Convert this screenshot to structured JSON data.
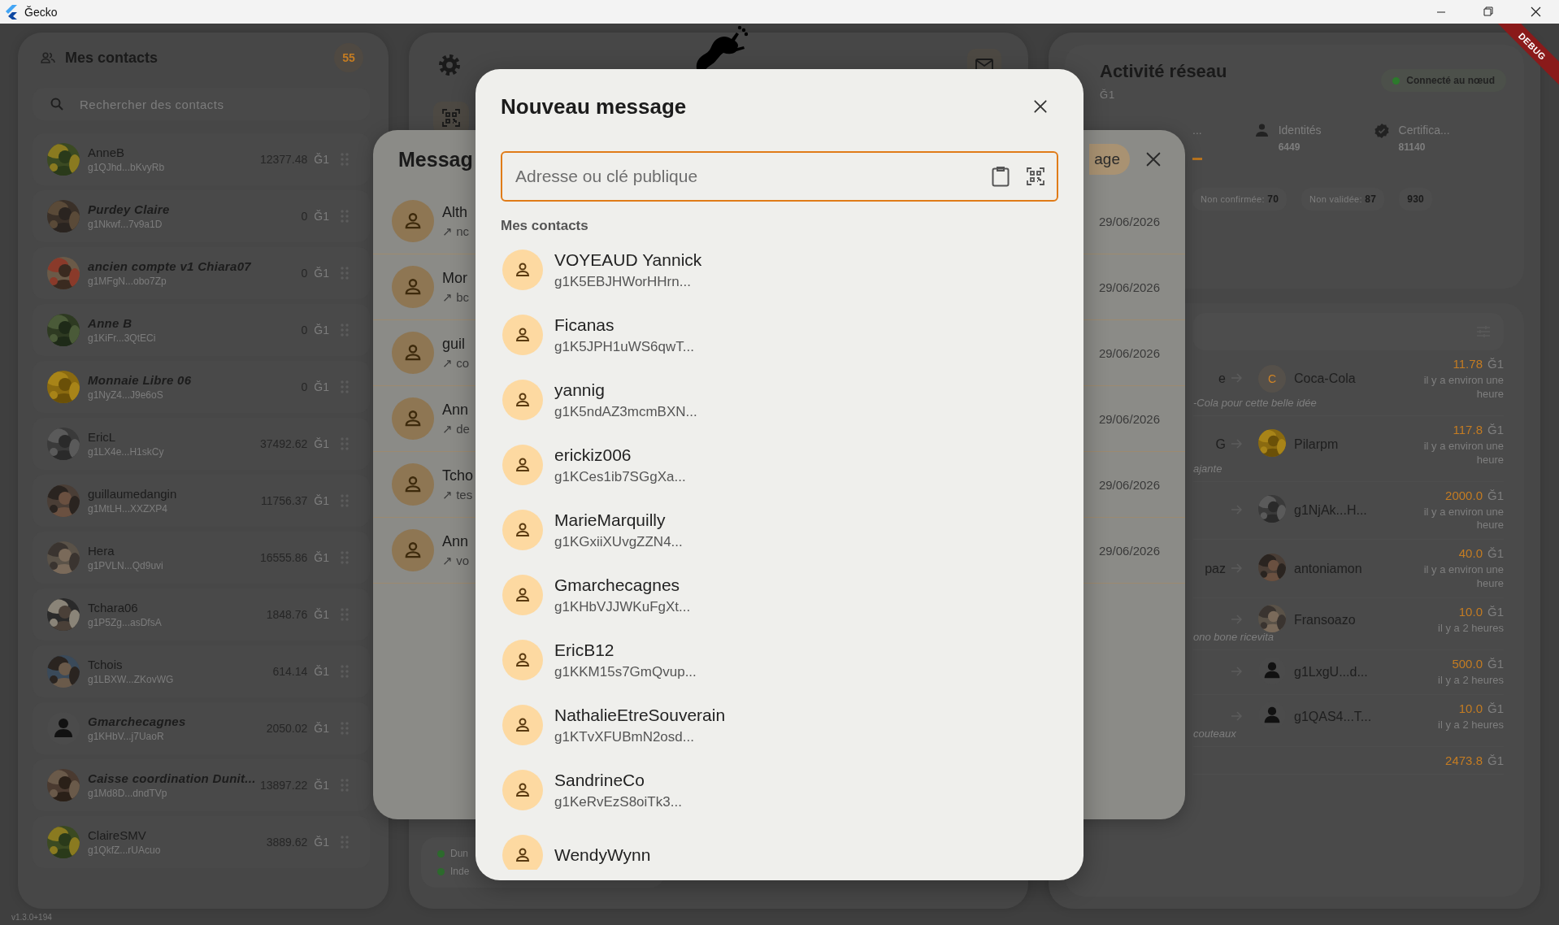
{
  "window": {
    "title": "Ğecko"
  },
  "debug_banner": "DEBUG",
  "contacts": {
    "title": "Mes contacts",
    "count": "55",
    "search": {
      "placeholder": "Rechercher des contacts"
    },
    "items": [
      {
        "name": "AnneB",
        "address": "g1QJhd...bKvyRb",
        "amount": "12377.48",
        "unit": "Ğ1",
        "italic": false
      },
      {
        "name": "Purdey Claire",
        "address": "g1Nkwf...7v9a1D",
        "amount": "0",
        "unit": "Ğ1",
        "italic": true
      },
      {
        "name": "ancien compte v1 Chiara07",
        "address": "g1MFgN...obo7Zp",
        "amount": "0",
        "unit": "Ğ1",
        "italic": true
      },
      {
        "name": "Anne B",
        "address": "g1KiFr...3QtECi",
        "amount": "0",
        "unit": "Ğ1",
        "italic": true
      },
      {
        "name": "Monnaie Libre 06",
        "address": "g1NyZ4...J9e6oS",
        "amount": "0",
        "unit": "Ğ1",
        "italic": true
      },
      {
        "name": "EricL",
        "address": "g1LX4e...H1skCy",
        "amount": "37492.62",
        "unit": "Ğ1",
        "italic": false
      },
      {
        "name": "guillaumedangin",
        "address": "g1MtLH...XXZXP4",
        "amount": "11756.37",
        "unit": "Ğ1",
        "italic": false
      },
      {
        "name": "Hera",
        "address": "g1PVLN...Qd9uvi",
        "amount": "16555.86",
        "unit": "Ğ1",
        "italic": false
      },
      {
        "name": "Tchara06",
        "address": "g1P5Zg...asDfsA",
        "amount": "1848.76",
        "unit": "Ğ1",
        "italic": false
      },
      {
        "name": "Tchois",
        "address": "g1LBXW...ZKovWG",
        "amount": "614.14",
        "unit": "Ğ1",
        "italic": false
      },
      {
        "name": "Gmarchecagnes",
        "address": "g1KHbV...j7UaoR",
        "amount": "2050.02",
        "unit": "Ğ1",
        "italic": true,
        "kind": "silhouette"
      },
      {
        "name": "Caisse coordination Dunit...",
        "address": "g1Md8D...dndTVp",
        "amount": "13897.22",
        "unit": "Ğ1",
        "italic": true
      },
      {
        "name": "ClaireSMV",
        "address": "g1QkfZ...rUAcuo",
        "amount": "3889.62",
        "unit": "Ğ1",
        "italic": false
      }
    ]
  },
  "version": "v1.3.0+194",
  "status": [
    {
      "label": "Dun",
      "connected": true
    },
    {
      "label": "Inde",
      "connected": true
    }
  ],
  "messages": {
    "title": "Messag",
    "action": "age",
    "items": [
      {
        "name": "Alth",
        "preview": "↗ nc",
        "date": "29/06/2026"
      },
      {
        "name": "Mor",
        "preview": "↗ bc",
        "date": "29/06/2026"
      },
      {
        "name": "guil",
        "preview": "↗ co",
        "date": "29/06/2026"
      },
      {
        "name": "Ann",
        "preview": "↗ de",
        "date": "29/06/2026"
      },
      {
        "name": "Tcho",
        "preview": "↗ tes",
        "date": "29/06/2026"
      },
      {
        "name": "Ann",
        "preview": "↗ vo",
        "date": "29/06/2026"
      }
    ]
  },
  "network": {
    "title": "Activité réseau",
    "currency": "Ğ1",
    "connection": {
      "label": "Connecté au nœud",
      "connected": true
    },
    "tabs": [
      {
        "label": "...",
        "selected": true
      },
      {
        "label": "Identités",
        "value": "6449",
        "selected": false
      },
      {
        "label": "Certifica...",
        "value": "81140",
        "selected": false
      }
    ],
    "chips": [
      {
        "text": "Non confirmée: **70**",
        "bold": false
      },
      {
        "text": "Non validée: **87**",
        "bold": false
      },
      {
        "text": "930",
        "bold": true
      }
    ],
    "transactions": [
      {
        "from": "e",
        "kind": "letter",
        "letter": "C",
        "to": "Coca-Cola",
        "amount": "11.78",
        "unit": "Ğ1",
        "time": "il y a environ une heure",
        "memo": "-Cola pour cette belle idée"
      },
      {
        "from": "G",
        "to": "Pilarpm",
        "amount": "117.8",
        "unit": "Ğ1",
        "time": "il y a environ une heure",
        "memo": "ajante"
      },
      {
        "to": "g1NjAk...H...",
        "amount": "2000.0",
        "unit": "Ğ1",
        "time": "il y a environ une heure"
      },
      {
        "from": "paz",
        "to": "antoniamon",
        "amount": "40.0",
        "unit": "Ğ1",
        "time": "il y a environ une heure"
      },
      {
        "to": "Fransoazo",
        "amount": "10.0",
        "unit": "Ğ1",
        "time": "il y a 2 heures",
        "memo": "ono bone ricevita"
      },
      {
        "kind": "silhouette",
        "to": "g1LxgU...d...",
        "amount": "500.0",
        "unit": "Ğ1",
        "time": "il y a 2 heures"
      },
      {
        "kind": "silhouette",
        "to": "g1QAS4...T...",
        "amount": "10.0",
        "unit": "Ğ1",
        "time": "il y a 2 heures",
        "memo": "couteaux"
      },
      {
        "amount": "2473.8",
        "unit": "Ğ1"
      }
    ]
  },
  "new_message": {
    "title": "Nouveau message",
    "field": {
      "placeholder": "Adresse ou clé publique"
    },
    "section": "Mes contacts",
    "contacts": [
      {
        "name": "VOYEAUD Yannick",
        "address": "g1K5EBJHWorHHrn..."
      },
      {
        "name": "Ficanas",
        "address": "g1K5JPH1uWS6qwT..."
      },
      {
        "name": "yannig",
        "address": "g1K5ndAZ3mcmBXN..."
      },
      {
        "name": "erickiz006",
        "address": "g1KCes1ib7SGgXa..."
      },
      {
        "name": "MarieMarquilly",
        "address": "g1KGxiiXUvgZZN4..."
      },
      {
        "name": "Gmarchecagnes",
        "address": "g1KHbVJJWKuFgXt..."
      },
      {
        "name": "EricB12",
        "address": "g1KKM15s7GmQvup..."
      },
      {
        "name": "NathalieEtreSouverain",
        "address": "g1KTvXFUBmN2osd..."
      },
      {
        "name": "SandrineCo",
        "address": "g1KeRvEzS8oiTk3..."
      },
      {
        "name": "WendyWynn"
      }
    ]
  }
}
